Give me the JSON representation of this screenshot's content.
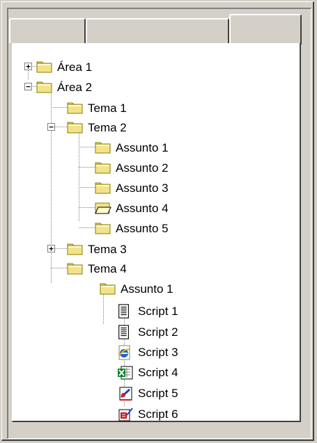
{
  "tabs": [
    "",
    "",
    ""
  ],
  "tree": [
    {
      "id": "area1",
      "label": "Área 1",
      "level": 0,
      "icon": "folder-closed-icon",
      "expander": "+"
    },
    {
      "id": "area2",
      "label": "Área 2",
      "level": 0,
      "icon": "folder-closed-icon",
      "expander": "-"
    },
    {
      "id": "tema1",
      "label": "Tema 1",
      "level": 1,
      "icon": "folder-closed-icon",
      "expander": ""
    },
    {
      "id": "tema2",
      "label": "Tema 2",
      "level": 1,
      "icon": "folder-closed-icon",
      "expander": "-"
    },
    {
      "id": "t2a1",
      "label": "Assunto 1",
      "level": 2,
      "icon": "folder-closed-icon",
      "expander": ""
    },
    {
      "id": "t2a2",
      "label": "Assunto 2",
      "level": 2,
      "icon": "folder-closed-icon",
      "expander": ""
    },
    {
      "id": "t2a3",
      "label": "Assunto 3",
      "level": 2,
      "icon": "folder-closed-icon",
      "expander": ""
    },
    {
      "id": "t2a4",
      "label": "Assunto 4",
      "level": 2,
      "icon": "folder-open-icon",
      "expander": ""
    },
    {
      "id": "t2a5",
      "label": "Assunto 5",
      "level": 2,
      "icon": "folder-closed-icon",
      "expander": ""
    },
    {
      "id": "tema3",
      "label": "Tema 3",
      "level": 1,
      "icon": "folder-closed-icon",
      "expander": "+"
    },
    {
      "id": "tema4",
      "label": "Tema 4",
      "level": 1,
      "icon": "folder-closed-icon",
      "expander": ""
    },
    {
      "id": "t4a1",
      "label": "Assunto 1",
      "level": 2,
      "icon": "folder-closed-icon",
      "expander": ""
    },
    {
      "id": "s1",
      "label": "Script 1",
      "level": 3,
      "icon": "text-document-icon",
      "expander": ""
    },
    {
      "id": "s2",
      "label": "Script 2",
      "level": 3,
      "icon": "text-document-icon",
      "expander": ""
    },
    {
      "id": "s3",
      "label": "Script 3",
      "level": 3,
      "icon": "internet-explorer-icon",
      "expander": ""
    },
    {
      "id": "s4",
      "label": "Script 4",
      "level": 3,
      "icon": "excel-document-icon",
      "expander": ""
    },
    {
      "id": "s5",
      "label": "Script 5",
      "level": 3,
      "icon": "paint-document-icon",
      "expander": ""
    },
    {
      "id": "s6",
      "label": "Script 6",
      "level": 3,
      "icon": "form-document-icon",
      "expander": ""
    }
  ]
}
